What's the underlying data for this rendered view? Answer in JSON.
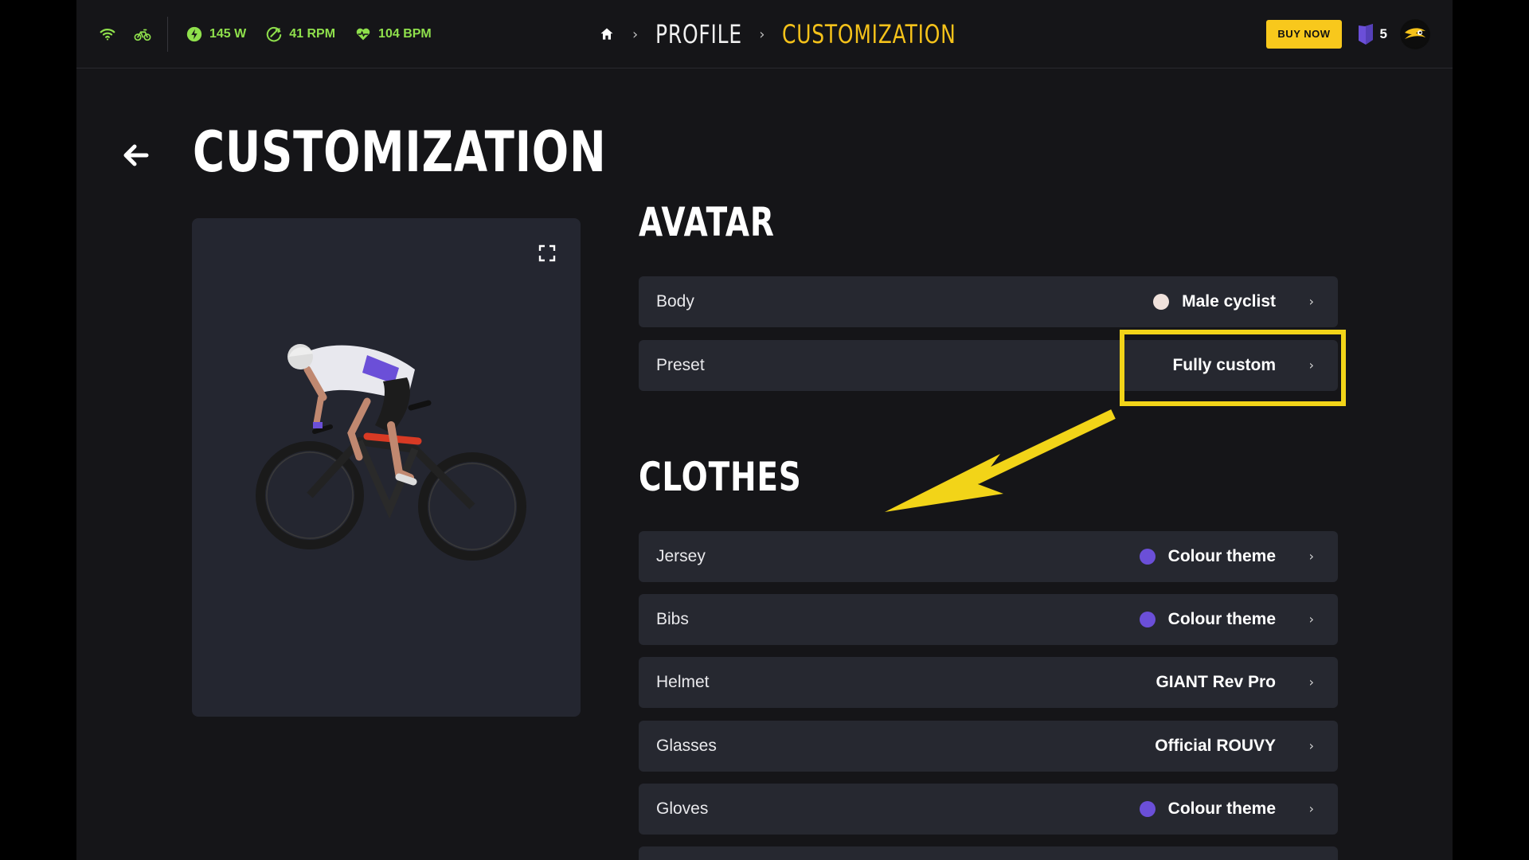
{
  "topbar": {
    "metrics": [
      {
        "icon": "power-icon",
        "value": "145 W"
      },
      {
        "icon": "cadence-icon",
        "value": "41 RPM"
      },
      {
        "icon": "heart-rate-icon",
        "value": "104 BPM"
      }
    ],
    "breadcrumb": {
      "profile": "PROFILE",
      "current": "CUSTOMIZATION"
    },
    "buy_now_label": "BUY NOW",
    "badge_count": "5"
  },
  "page": {
    "title": "CUSTOMIZATION"
  },
  "sections": {
    "avatar": {
      "title": "AVATAR",
      "rows": [
        {
          "label": "Body",
          "value": "Male cyclist",
          "swatch": "#f0e2dc"
        },
        {
          "label": "Preset",
          "value": "Fully custom"
        }
      ]
    },
    "clothes": {
      "title": "CLOTHES",
      "rows": [
        {
          "label": "Jersey",
          "value": "Colour theme",
          "swatch": "#6b4fd8"
        },
        {
          "label": "Bibs",
          "value": "Colour theme",
          "swatch": "#6b4fd8"
        },
        {
          "label": "Helmet",
          "value": "GIANT Rev Pro"
        },
        {
          "label": "Glasses",
          "value": "Official ROUVY"
        },
        {
          "label": "Gloves",
          "value": "Colour theme",
          "swatch": "#6b4fd8"
        }
      ]
    }
  },
  "colors": {
    "accent": "#f5c21a",
    "metric": "#8fe04c",
    "highlight": "#f2d418"
  }
}
